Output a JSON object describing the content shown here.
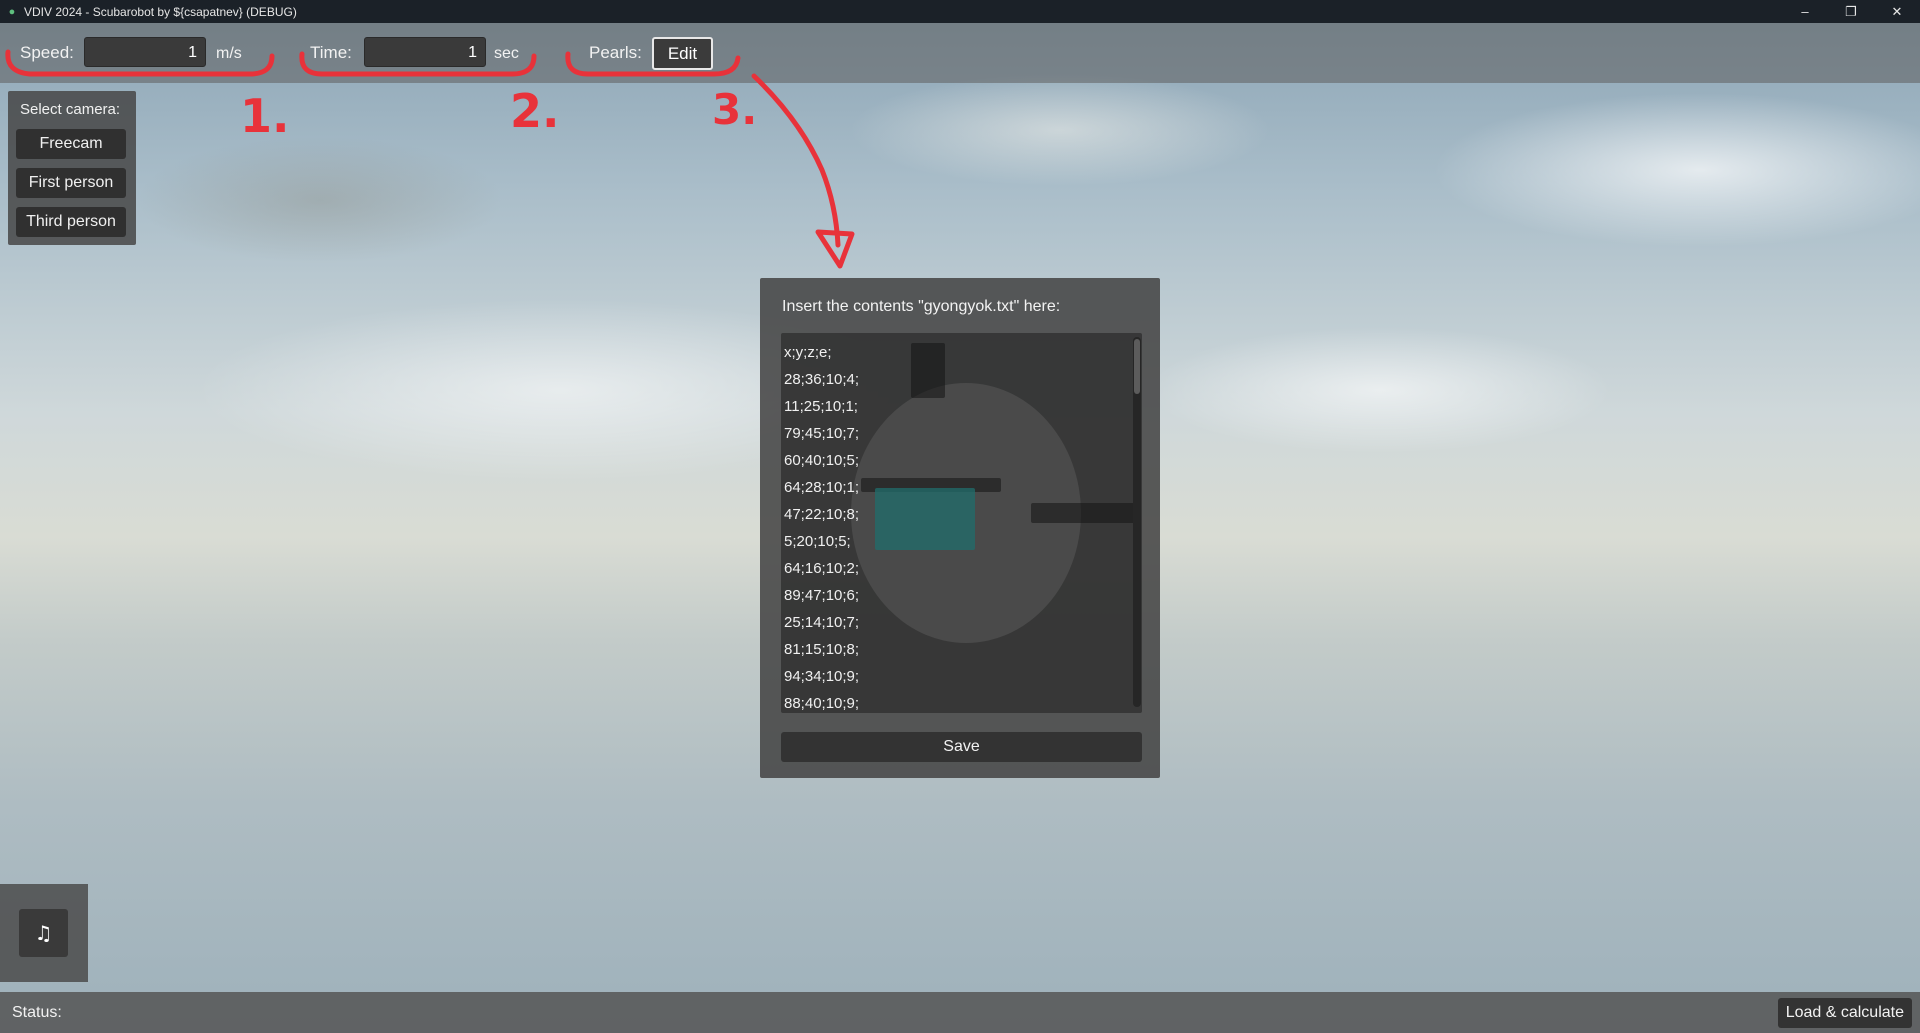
{
  "window": {
    "title": "VDIV 2024 - Scubarobot by ${csapatnev} (DEBUG)",
    "icon": "android-icon",
    "controls": {
      "minimize": "–",
      "restore": "❐",
      "close": "✕"
    }
  },
  "toolbar": {
    "speed_label": "Speed:",
    "speed_value": "1",
    "speed_unit": "m/s",
    "time_label": "Time:",
    "time_value": "1",
    "time_unit": "sec",
    "pearls_label": "Pearls:",
    "edit_label": "Edit"
  },
  "annotations": {
    "one": "1.",
    "two": "2.",
    "three": "3.",
    "color": "#e8323a"
  },
  "camera": {
    "title": "Select camera:",
    "options": [
      "Freecam",
      "First person",
      "Third person"
    ]
  },
  "dialog": {
    "prompt": "Insert the contents \"gyongyok.txt\" here:",
    "lines": [
      "x;y;z;e;",
      "28;36;10;4;",
      "11;25;10;1;",
      "79;45;10;7;",
      "60;40;10;5;",
      "64;28;10;1;",
      "47;22;10;8;",
      "5;20;10;5;",
      "64;16;10;2;",
      "89;47;10;6;",
      "25;14;10;7;",
      "81;15;10;8;",
      "94;34;10;9;",
      "88;40;10;9;"
    ],
    "save_label": "Save"
  },
  "music": {
    "icon": "music-note-icon",
    "glyph": "♫"
  },
  "status": {
    "label": "Status:",
    "load_label": "Load & calculate"
  }
}
